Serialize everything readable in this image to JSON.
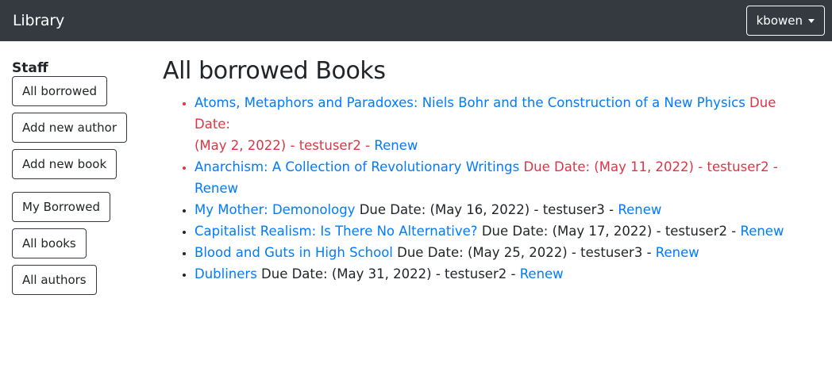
{
  "navbar": {
    "brand": "Library",
    "user": "kbowen"
  },
  "sidebar": {
    "title": "Staff",
    "staff_items": [
      {
        "label": "All borrowed"
      },
      {
        "label": "Add new author"
      },
      {
        "label": "Add new book"
      }
    ],
    "user_items": [
      {
        "label": "My Borrowed"
      },
      {
        "label": "All books"
      },
      {
        "label": "All authors"
      }
    ]
  },
  "main": {
    "title": "All borrowed Books",
    "loans": [
      {
        "book": "Atoms, Metaphors and Paradoxes: Niels Bohr and the Construction of a New Physics",
        "due_label": "Due Date:",
        "due_date": "(May 2, 2022)",
        "borrower": "testuser2",
        "sep": "-",
        "renew": "Renew",
        "overdue": true
      },
      {
        "book": "Anarchism: A Collection of Revolutionary Writings",
        "due_label": "Due Date:",
        "due_date": "(May 11, 2022)",
        "borrower": "testuser2",
        "sep": "-",
        "renew": "Renew",
        "overdue": true
      },
      {
        "book": "My Mother: Demonology",
        "due_label": "Due Date:",
        "due_date": "(May 16, 2022)",
        "borrower": "testuser3",
        "sep": "-",
        "renew": "Renew",
        "overdue": false
      },
      {
        "book": "Capitalist Realism: Is There No Alternative?",
        "due_label": "Due Date:",
        "due_date": "(May 17, 2022)",
        "borrower": "testuser2",
        "sep": "-",
        "renew": "Renew",
        "overdue": false
      },
      {
        "book": "Blood and Guts in High School",
        "due_label": "Due Date:",
        "due_date": "(May 25, 2022)",
        "borrower": "testuser3",
        "sep": "-",
        "renew": "Renew",
        "overdue": false
      },
      {
        "book": "Dubliners",
        "due_label": "Due Date:",
        "due_date": "(May 31, 2022)",
        "borrower": "testuser2",
        "sep": "-",
        "renew": "Renew",
        "overdue": false
      }
    ]
  },
  "colors": {
    "navbar_bg": "#343a40",
    "link": "#007bff",
    "overdue": "#dc3545",
    "text": "#212529"
  }
}
